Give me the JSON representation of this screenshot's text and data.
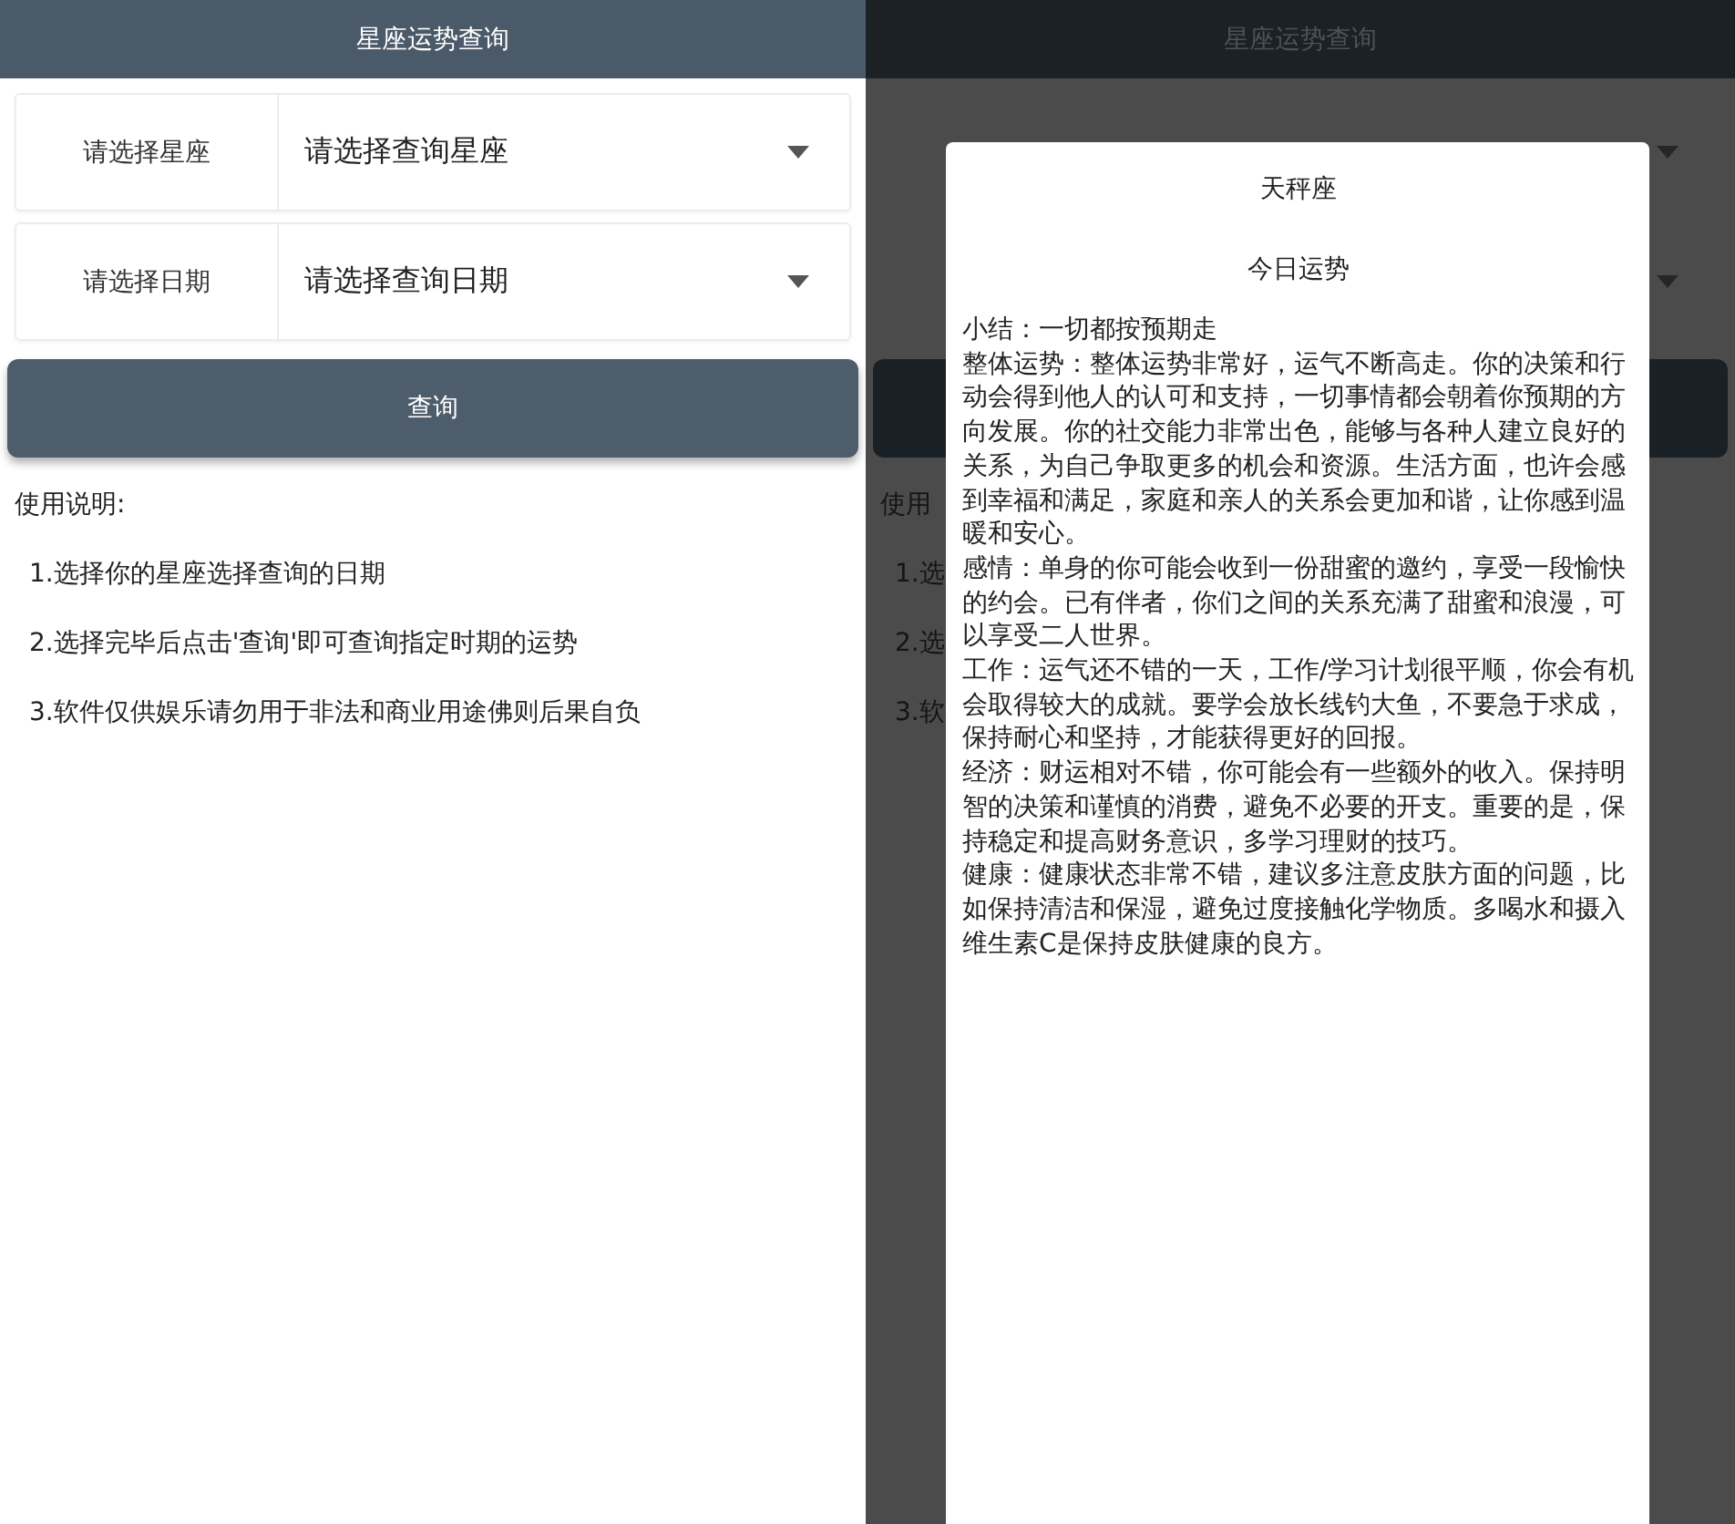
{
  "main_screen": {
    "title": "星座运势查询",
    "fields": [
      {
        "label": "请选择星座",
        "value": "请选择查询星座"
      },
      {
        "label": "请选择日期",
        "value": "请选择查询日期"
      }
    ],
    "button": "查询",
    "instructions_title": "使用说明:",
    "instructions": [
      "1.选择你的星座选择查询的日期",
      "2.选择完毕后点击'查询'即可查询指定时期的运势",
      "3.软件仅供娱乐请勿用于非法和商业用途佛则后果自负"
    ]
  },
  "dimmed_screen": {
    "title": "星座运势查询",
    "instructions_title": "使用",
    "instructions": [
      "1.选",
      "2.选",
      "3.软"
    ]
  },
  "dialog": {
    "title": "天秤座",
    "subtitle": "今日运势",
    "paragraphs": [
      "小结：一切都按预期走",
      "整体运势：整体运势非常好，运气不断高走。你的决策和行动会得到他人的认可和支持，一切事情都会朝着你预期的方向发展。你的社交能力非常出色，能够与各种人建立良好的关系，为自己争取更多的机会和资源。生活方面，也许会感到幸福和满足，家庭和亲人的关系会更加和谐，让你感到温暖和安心。",
      "感情：单身的你可能会收到一份甜蜜的邀约，享受一段愉快的约会。已有伴者，你们之间的关系充满了甜蜜和浪漫，可以享受二人世界。",
      "工作：运气还不错的一天，工作/学习计划很平顺，你会有机会取得较大的成就。要学会放长线钓大鱼，不要急于求成，保持耐心和坚持，才能获得更好的回报。",
      "经济：财运相对不错，你可能会有一些额外的收入。保持明智的决策和谨慎的消费，避免不必要的开支。重要的是，保持稳定和提高财务意识，多学习理财的技巧。",
      "健康：健康状态非常不错，建议多注意皮肤方面的问题，比如保持清洁和保湿，避免过度接触化学物质。多喝水和摄入维生素C是保持皮肤健康的良方。"
    ]
  }
}
